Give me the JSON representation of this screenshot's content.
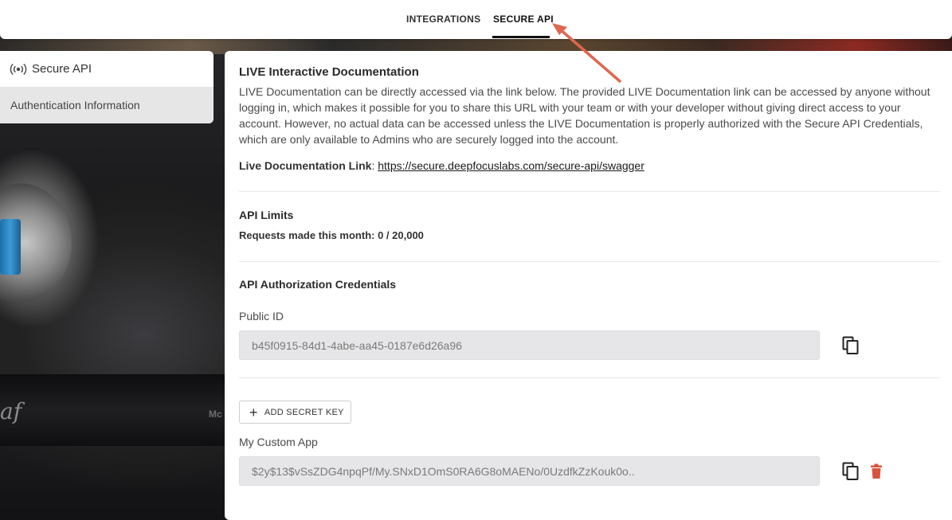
{
  "tabs": [
    {
      "label": "INTEGRATIONS",
      "active": false
    },
    {
      "label": "SECURE API",
      "active": true
    }
  ],
  "sidebar": {
    "title": "Secure API",
    "title_icon": "broadcast-icon",
    "items": [
      {
        "label": "Authentication Information",
        "active": true
      }
    ]
  },
  "docs": {
    "heading": "LIVE Interactive Documentation",
    "description": "LIVE Documentation can be directly accessed via the link below. The provided LIVE Documentation link can be accessed by anyone without logging in, which makes it possible for you to share this URL with your team or with your developer without giving direct access to your account. However, no actual data can be accessed unless the LIVE Documentation is properly authorized with the Secure API Credentials, which are only available to Admins who are securely logged into the account.",
    "link_label": "Live Documentation Link",
    "link_separator": ":",
    "link_url": "https://secure.deepfocuslabs.com/secure-api/swagger"
  },
  "limits": {
    "heading": "API Limits",
    "requests_text": "Requests made this month: 0 / 20,000"
  },
  "credentials": {
    "heading": "API Authorization Credentials",
    "public_id_label": "Public ID",
    "public_id_value": "b45f0915-84d1-4abe-aa45-0187e6d26a96",
    "add_secret_label": "ADD SECRET KEY",
    "secret_keys": [
      {
        "name": "My Custom App",
        "value": "$2y$13$vSsZDG4npqPf/My.SNxD1OmS0RA6G8oMAENo/0UzdfkZzKouk0o.."
      }
    ]
  },
  "background_text": {
    "mark": "Mc",
    "script": "af"
  },
  "colors": {
    "accent": "#111111",
    "delete": "#d9543c",
    "annotation_arrow": "#e0664f"
  }
}
